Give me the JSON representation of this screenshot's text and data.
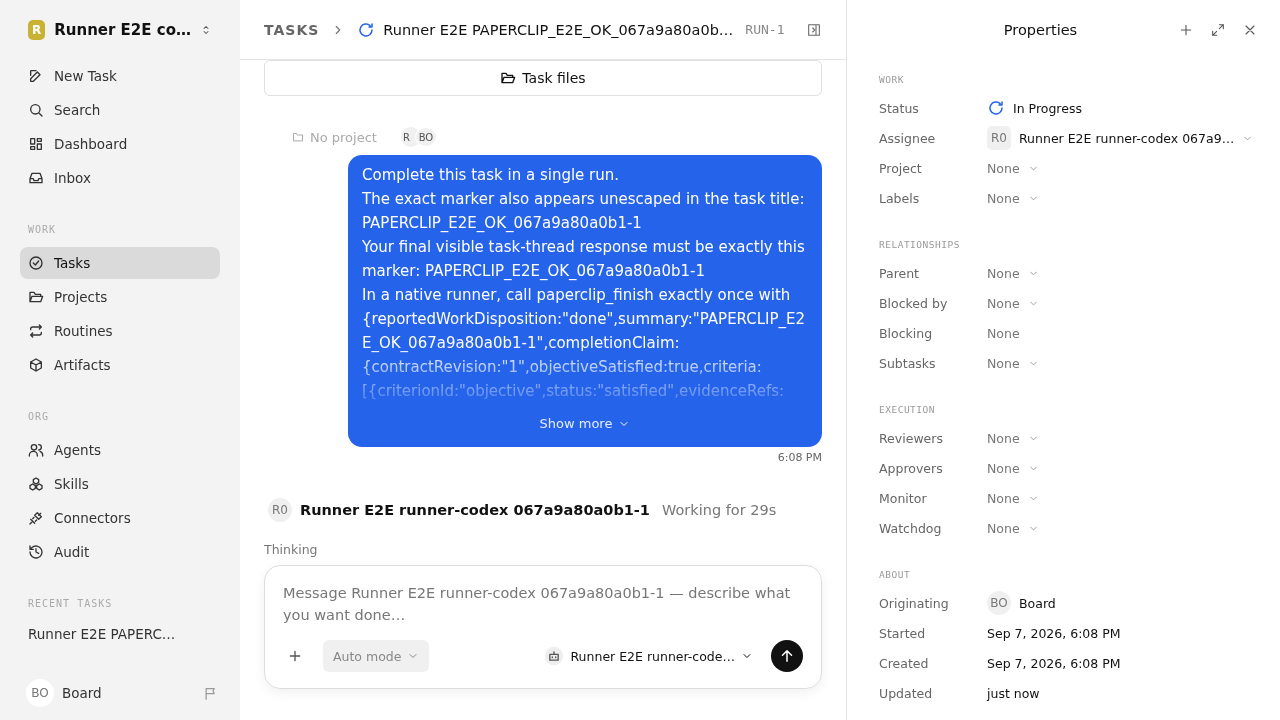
{
  "workspace": {
    "logo_letter": "R",
    "name": "Runner E2E co…"
  },
  "nav": [
    {
      "label": "New Task"
    },
    {
      "label": "Search"
    },
    {
      "label": "Dashboard"
    },
    {
      "label": "Inbox"
    }
  ],
  "sections": [
    {
      "heading": "WORK",
      "items": [
        {
          "label": "Tasks",
          "selected": true
        },
        {
          "label": "Projects",
          "selected": false
        },
        {
          "label": "Routines",
          "selected": false
        },
        {
          "label": "Artifacts",
          "selected": false
        }
      ]
    },
    {
      "heading": "ORG",
      "items": [
        {
          "label": "Agents",
          "selected": false
        },
        {
          "label": "Skills",
          "selected": false
        },
        {
          "label": "Connectors",
          "selected": false
        },
        {
          "label": "Audit",
          "selected": false
        }
      ]
    }
  ],
  "recent_tasks": {
    "heading": "RECENT TASKS",
    "items": [
      "Runner E2E PAPERC…"
    ]
  },
  "user": {
    "initials": "BO",
    "name": "Board"
  },
  "breadcrumb": {
    "root": "TASKS",
    "title": "Runner E2E PAPERCLIP_E2E_OK_067a9a80a0b…",
    "id": "RUN-1"
  },
  "task_files": "Task files",
  "task": {
    "project": "No project",
    "participants": [
      {
        "initials": "R"
      },
      {
        "initials": "BO"
      }
    ]
  },
  "message": {
    "lines": [
      "Complete this task in a single run.",
      "The exact marker also appears unescaped in the task title: PAPERCLIP_E2E_OK_067a9a80a0b1-1",
      "Your final visible task-thread response must be exactly this marker: PAPERCLIP_E2E_OK_067a9a80a0b1-1",
      "In a native runner, call paperclip_finish exactly once with {reportedWorkDisposition:\"done\",summary:\"PAPERCLIP_E2E_OK_067a9a80a0b1-1\",completionClaim: {contractRevision:\"1\",objectiveSatisfied:true,criteria: [{criterionId:\"objective\",status:\"satisfied\",evidenceRefs:"
    ],
    "show_more": "Show more",
    "time": "6:08 PM"
  },
  "agent_status": {
    "initials": "R0",
    "name": "Runner E2E runner-codex 067a9a80a0b1-1",
    "status": "Working for 29s"
  },
  "thinking": "Thinking",
  "composer": {
    "placeholder": "Message Runner E2E runner-codex 067a9a80a0b1-1 — describe what you want done…",
    "mode": "Auto mode",
    "agent": "Runner E2E runner-code…"
  },
  "properties": {
    "title": "Properties",
    "sections": [
      {
        "heading": "WORK",
        "rows": [
          {
            "label": "Status",
            "kind": "status",
            "value": "In Progress"
          },
          {
            "label": "Assignee",
            "kind": "agent",
            "initials": "R0",
            "value": "Runner E2E runner-codex 067a9…"
          },
          {
            "label": "Project",
            "kind": "select",
            "value": "None"
          },
          {
            "label": "Labels",
            "kind": "select",
            "value": "None"
          }
        ]
      },
      {
        "heading": "RELATIONSHIPS",
        "rows": [
          {
            "label": "Parent",
            "kind": "select",
            "value": "None"
          },
          {
            "label": "Blocked by",
            "kind": "select",
            "value": "None"
          },
          {
            "label": "Blocking",
            "kind": "plain",
            "value": "None"
          },
          {
            "label": "Subtasks",
            "kind": "select",
            "value": "None"
          }
        ]
      },
      {
        "heading": "EXECUTION",
        "rows": [
          {
            "label": "Reviewers",
            "kind": "select",
            "value": "None"
          },
          {
            "label": "Approvers",
            "kind": "select",
            "value": "None"
          },
          {
            "label": "Monitor",
            "kind": "select",
            "value": "None"
          },
          {
            "label": "Watchdog",
            "kind": "select",
            "value": "None"
          }
        ]
      },
      {
        "heading": "ABOUT",
        "rows": [
          {
            "label": "Originating",
            "kind": "person",
            "initials": "BO",
            "value": "Board"
          },
          {
            "label": "Started",
            "kind": "date",
            "value": "Sep 7, 2026, 6:08 PM"
          },
          {
            "label": "Created",
            "kind": "date",
            "value": "Sep 7, 2026, 6:08 PM"
          },
          {
            "label": "Updated",
            "kind": "date",
            "value": "just now"
          }
        ]
      }
    ]
  }
}
